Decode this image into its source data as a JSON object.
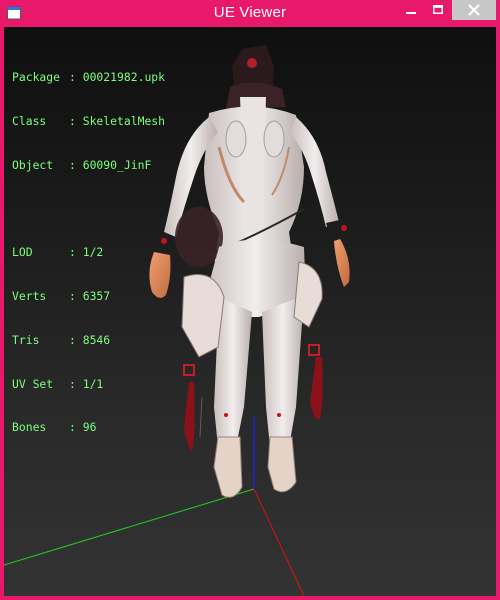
{
  "window": {
    "title": "UE Viewer",
    "controls": {
      "minimize": "minimize-icon",
      "maximize": "maximize-icon",
      "close": "close-icon"
    }
  },
  "info": {
    "package": {
      "label": "Package",
      "value": "00021982.upk"
    },
    "class": {
      "label": "Class",
      "value": "SkeletalMesh"
    },
    "object": {
      "label": "Object",
      "value": "60090_JinF"
    },
    "lod": {
      "label": "LOD",
      "value": "1/2"
    },
    "verts": {
      "label": "Verts",
      "value": "6357"
    },
    "tris": {
      "label": "Tris",
      "value": "8546"
    },
    "uvset": {
      "label": "UV Set",
      "value": "1/1"
    },
    "bones": {
      "label": "Bones",
      "value": "96"
    },
    "separator": ": "
  },
  "colors": {
    "title_bar": "#e8186a",
    "info_text": "#7dff7d",
    "axis_x": "#e01010",
    "axis_y": "#20d020",
    "axis_z": "#2020e0"
  }
}
